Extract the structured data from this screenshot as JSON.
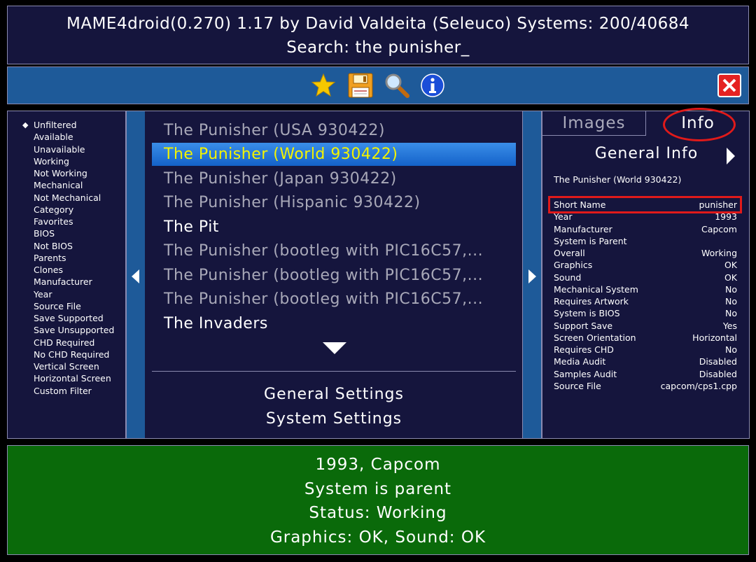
{
  "header": {
    "title": "MAME4droid(0.270) 1.17 by David Valdeita (Seleuco) Systems: 200/40684",
    "search": "Search: the punisher_"
  },
  "toolbar": {
    "icons": [
      "favorites-star-icon",
      "save-floppy-icon",
      "search-magnifier-icon",
      "info-icon",
      "close-icon"
    ]
  },
  "filters": {
    "selected": "Unfiltered",
    "items": [
      "Unfiltered",
      "Available",
      "Unavailable",
      "Working",
      "Not Working",
      "Mechanical",
      "Not Mechanical",
      "Category",
      "Favorites",
      "BIOS",
      "Not BIOS",
      "Parents",
      "Clones",
      "Manufacturer",
      "Year",
      "Source File",
      "Save Supported",
      "Save Unsupported",
      "CHD Required",
      "No CHD Required",
      "Vertical Screen",
      "Horizontal Screen",
      "Custom Filter"
    ]
  },
  "games": {
    "items": [
      {
        "name": "The Punisher (USA 930422)",
        "state": "dim"
      },
      {
        "name": "The Punisher (World 930422)",
        "state": "selected"
      },
      {
        "name": "The Punisher (Japan 930422)",
        "state": "dim"
      },
      {
        "name": "The Punisher (Hispanic 930422)",
        "state": "dim"
      },
      {
        "name": "The Pit",
        "state": "normal"
      },
      {
        "name": "The Punisher (bootleg with PIC16C57,...",
        "state": "dim"
      },
      {
        "name": "The Punisher (bootleg with PIC16C57,...",
        "state": "dim"
      },
      {
        "name": "The Punisher (bootleg with PIC16C57,...",
        "state": "dim"
      },
      {
        "name": "The Invaders",
        "state": "normal"
      }
    ],
    "general_settings": "General Settings",
    "system_settings": "System Settings"
  },
  "info": {
    "tab_images": "Images",
    "tab_info": "Info",
    "section_title": "General Info",
    "game_name": "The Punisher (World 930422)",
    "rows": [
      {
        "key": "Short Name",
        "value": "punisher"
      },
      {
        "key": "Year",
        "value": "1993"
      },
      {
        "key": "Manufacturer",
        "value": "Capcom"
      },
      {
        "key": "System is Parent",
        "value": ""
      },
      {
        "key": "Overall",
        "value": "Working"
      },
      {
        "key": "Graphics",
        "value": "OK"
      },
      {
        "key": "Sound",
        "value": "OK"
      },
      {
        "key": "Mechanical System",
        "value": "No"
      },
      {
        "key": "Requires Artwork",
        "value": "No"
      },
      {
        "key": "System is BIOS",
        "value": "No"
      },
      {
        "key": "Support Save",
        "value": "Yes"
      },
      {
        "key": "Screen Orientation",
        "value": "Horizontal"
      },
      {
        "key": "Requires CHD",
        "value": "No"
      },
      {
        "key": "Media Audit",
        "value": "Disabled"
      },
      {
        "key": "Samples Audit",
        "value": "Disabled"
      },
      {
        "key": "Source File",
        "value": "capcom/cps1.cpp"
      }
    ]
  },
  "footer": {
    "lines": [
      "1993, Capcom",
      "System is parent",
      "Status: Working",
      "Graphics: OK, Sound: OK"
    ]
  },
  "colors": {
    "panel_bg": "#15153d",
    "toolbar_bg": "#1e5a99",
    "selected_text": "#f3f300",
    "highlight_red": "#e01a1a",
    "footer_bg": "#0a6a0a"
  }
}
